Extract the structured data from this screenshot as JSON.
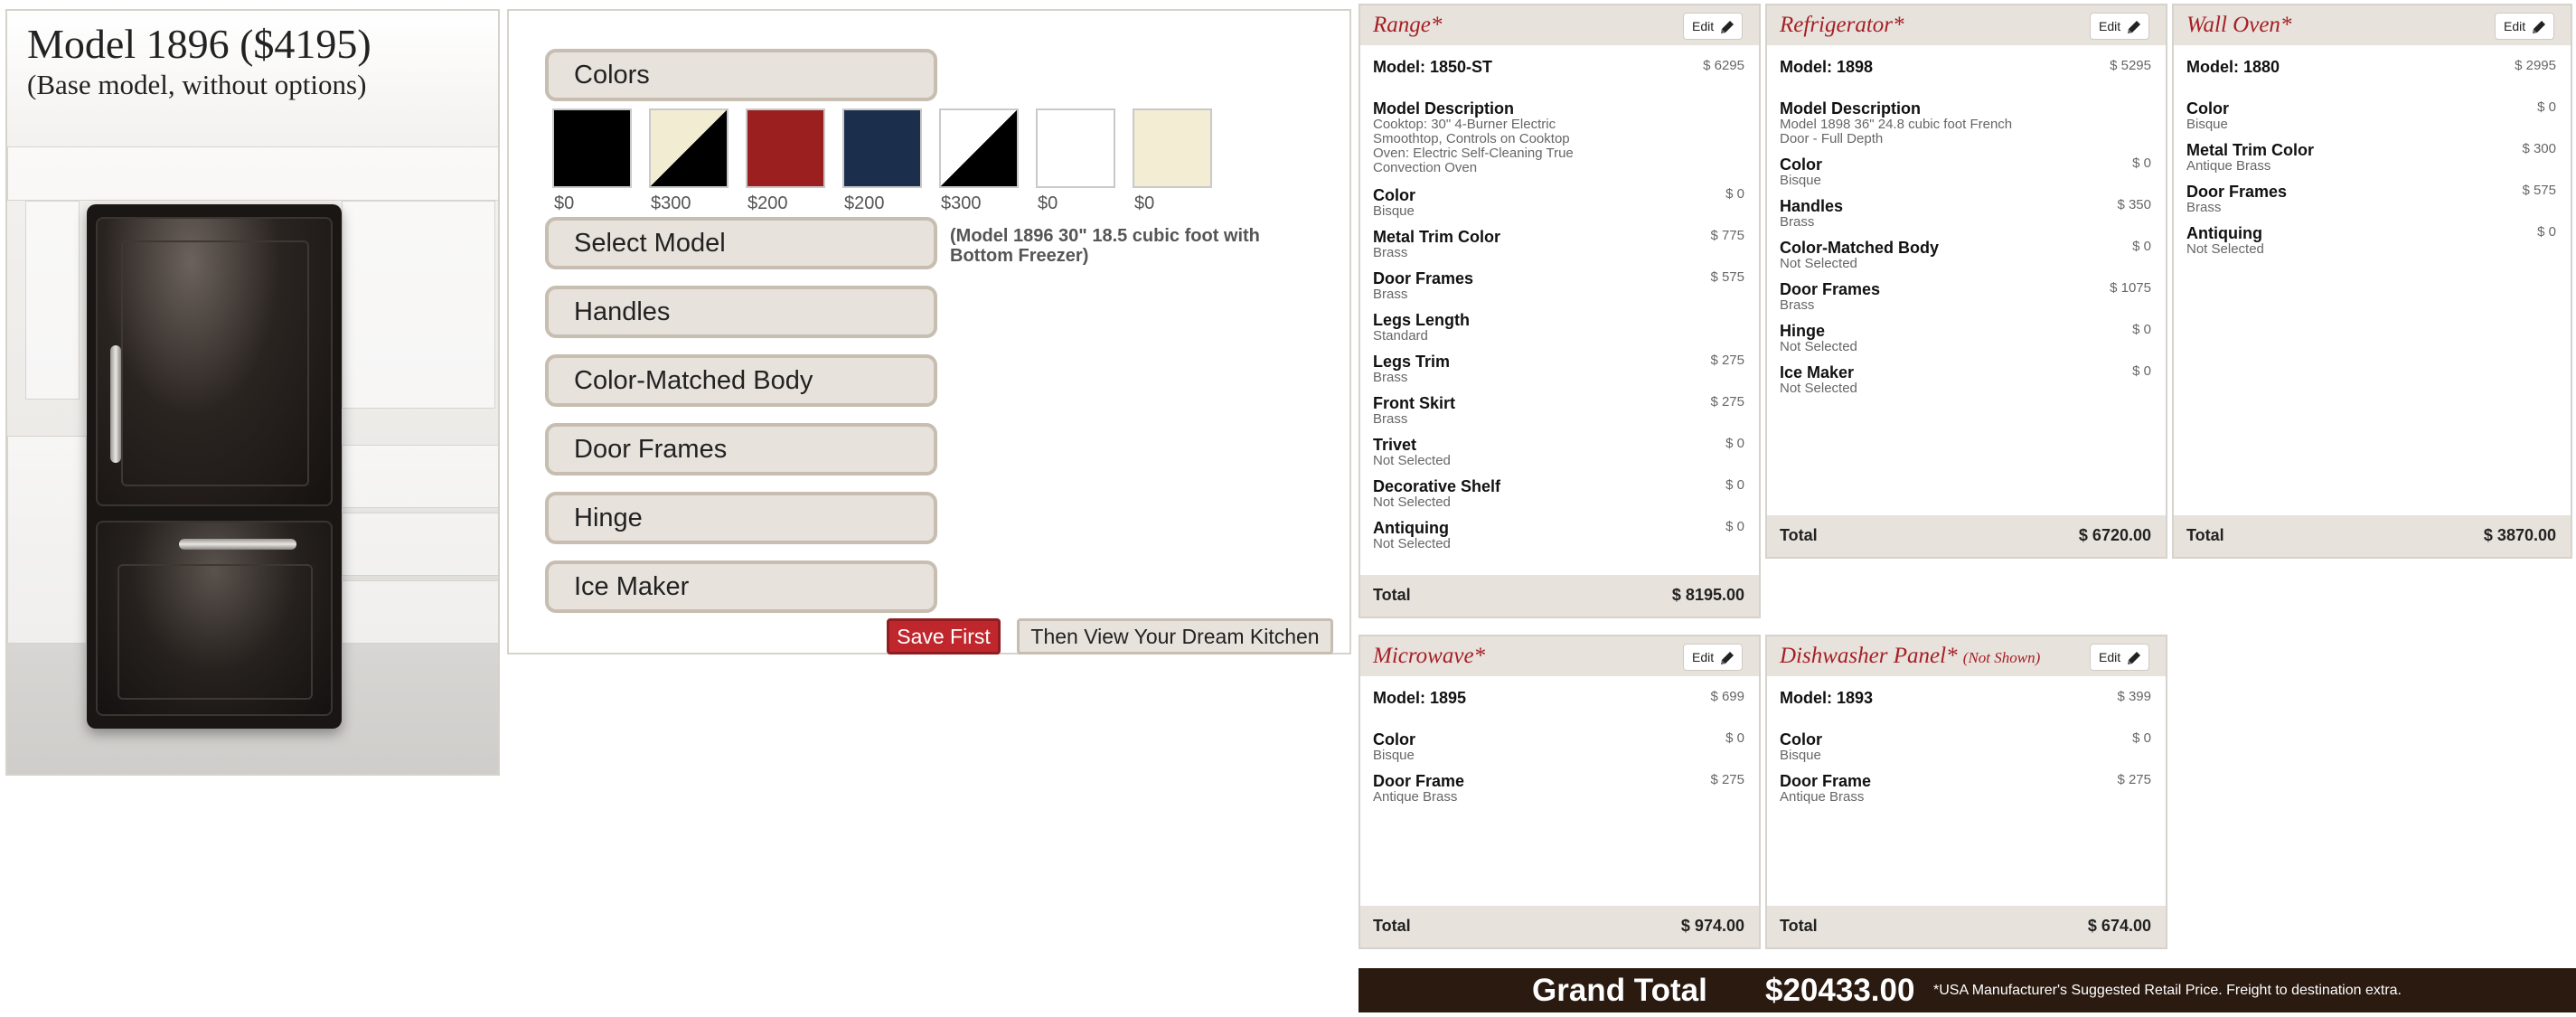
{
  "model_panel": {
    "title": "Model 1896 ($4195)",
    "subtitle": "(Base model, without options)"
  },
  "options": {
    "buttons": {
      "colors": "Colors",
      "select_model": "Select Model",
      "handles": "Handles",
      "color_matched_body": "Color-Matched Body",
      "door_frames": "Door Frames",
      "hinge": "Hinge",
      "ice_maker": "Ice Maker"
    },
    "swatches": [
      {
        "price": "$0",
        "color": "#000000"
      },
      {
        "price": "$300",
        "color": "#f2ecd2",
        "split": "#000000"
      },
      {
        "price": "$200",
        "color": "#9b1f1f"
      },
      {
        "price": "$200",
        "color": "#1b2f4d"
      },
      {
        "price": "$300",
        "color": "#ffffff",
        "split": "#000000"
      },
      {
        "price": "$0",
        "color": "#ffffff"
      },
      {
        "price": "$0",
        "color": "#f3edd3"
      }
    ],
    "model_description": "(Model 1896 30\" 18.5 cubic foot with Bottom Freezer)",
    "save_first": "Save First",
    "view_kitchen": "Then View Your Dream Kitchen"
  },
  "cards": {
    "range": {
      "title": "Range*",
      "edit": "Edit",
      "model_label": "Model: 1850-ST",
      "model_price": "$ 6295",
      "rows": [
        {
          "name": "Model Description",
          "value": "Cooktop: 30\" 4-Burner Electric Smoothtop, Controls on Cooktop Oven: Electric Self-Cleaning True Convection Oven",
          "price": ""
        },
        {
          "name": "Color",
          "value": "Bisque",
          "price": "$ 0"
        },
        {
          "name": "Metal Trim Color",
          "value": "Brass",
          "price": "$ 775"
        },
        {
          "name": "Door Frames",
          "value": "Brass",
          "price": "$ 575"
        },
        {
          "name": "Legs Length",
          "value": "Standard",
          "price": ""
        },
        {
          "name": "Legs Trim",
          "value": "Brass",
          "price": "$ 275"
        },
        {
          "name": "Front Skirt",
          "value": "Brass",
          "price": "$ 275"
        },
        {
          "name": "Trivet",
          "value": "Not Selected",
          "price": "$ 0"
        },
        {
          "name": "Decorative Shelf",
          "value": "Not Selected",
          "price": "$ 0"
        },
        {
          "name": "Antiquing",
          "value": "Not Selected",
          "price": "$ 0"
        }
      ],
      "total_label": "Total",
      "total": "$ 8195.00"
    },
    "refrigerator": {
      "title": "Refrigerator*",
      "edit": "Edit",
      "model_label": "Model: 1898",
      "model_price": "$ 5295",
      "rows": [
        {
          "name": "Model Description",
          "value": "Model 1898 36\" 24.8 cubic foot French Door - Full Depth",
          "price": ""
        },
        {
          "name": "Color",
          "value": "Bisque",
          "price": "$ 0"
        },
        {
          "name": "Handles",
          "value": "Brass",
          "price": "$ 350"
        },
        {
          "name": "Color-Matched Body",
          "value": "Not Selected",
          "price": "$ 0"
        },
        {
          "name": "Door Frames",
          "value": "Brass",
          "price": "$ 1075"
        },
        {
          "name": "Hinge",
          "value": "Not Selected",
          "price": "$ 0"
        },
        {
          "name": "Ice Maker",
          "value": "Not Selected",
          "price": "$ 0"
        }
      ],
      "total_label": "Total",
      "total": "$ 6720.00"
    },
    "wall_oven": {
      "title": "Wall Oven*",
      "edit": "Edit",
      "model_label": "Model: 1880",
      "model_price": "$ 2995",
      "rows": [
        {
          "name": "Color",
          "value": "Bisque",
          "price": "$ 0"
        },
        {
          "name": "Metal Trim Color",
          "value": "Antique Brass",
          "price": "$ 300"
        },
        {
          "name": "Door Frames",
          "value": "Brass",
          "price": "$ 575"
        },
        {
          "name": "Antiquing",
          "value": "Not Selected",
          "price": "$ 0"
        }
      ],
      "total_label": "Total",
      "total": "$ 3870.00"
    },
    "microwave": {
      "title": "Microwave*",
      "edit": "Edit",
      "model_label": "Model: 1895",
      "model_price": "$ 699",
      "rows": [
        {
          "name": "Color",
          "value": "Bisque",
          "price": "$ 0"
        },
        {
          "name": "Door Frame",
          "value": "Antique Brass",
          "price": "$ 275"
        }
      ],
      "total_label": "Total",
      "total": "$ 974.00"
    },
    "dishwasher": {
      "title": "Dishwasher Panel*",
      "note": "(Not Shown)",
      "edit": "Edit",
      "model_label": "Model: 1893",
      "model_price": "$ 399",
      "rows": [
        {
          "name": "Color",
          "value": "Bisque",
          "price": "$ 0"
        },
        {
          "name": "Door Frame",
          "value": "Antique Brass",
          "price": "$ 275"
        }
      ],
      "total_label": "Total",
      "total": "$ 674.00"
    }
  },
  "grand_total": {
    "label": "Grand Total",
    "amount": "$20433.00",
    "disclaimer": "*USA Manufacturer's Suggested Retail Price. Freight to destination extra."
  },
  "colors": {
    "accent_red": "#a51f25",
    "panel_beige": "#e8e2dc",
    "grand_total_bg": "#2a1a10"
  }
}
